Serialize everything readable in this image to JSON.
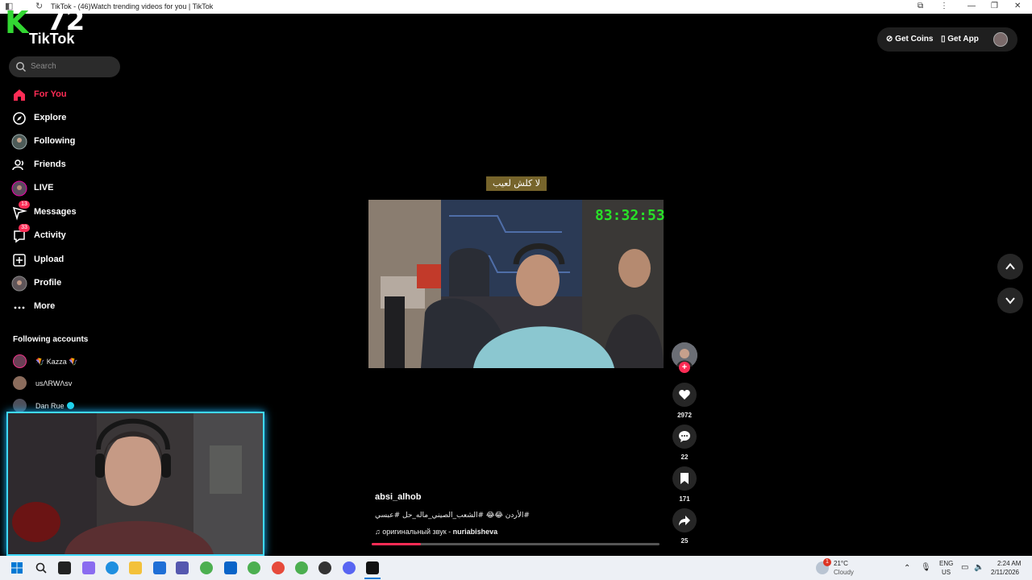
{
  "browser": {
    "title": "TikTok - (46)Watch trending videos for you | TikTok"
  },
  "overlay_logo": {
    "k": "K",
    "number": "72"
  },
  "app": {
    "logo_text": "TikTok"
  },
  "search": {
    "placeholder": "Search"
  },
  "sidebar": {
    "items": [
      {
        "label": "For You",
        "icon": "home-icon",
        "active": true
      },
      {
        "label": "Explore",
        "icon": "compass-icon"
      },
      {
        "label": "Following",
        "icon": "following-avatar-icon"
      },
      {
        "label": "Friends",
        "icon": "friends-icon"
      },
      {
        "label": "LIVE",
        "icon": "live-avatar-icon"
      },
      {
        "label": "Messages",
        "icon": "messages-icon",
        "badge": "13"
      },
      {
        "label": "Activity",
        "icon": "activity-icon",
        "badge": "33"
      },
      {
        "label": "Upload",
        "icon": "upload-icon"
      },
      {
        "label": "Profile",
        "icon": "profile-avatar-icon"
      },
      {
        "label": "More",
        "icon": "more-icon"
      }
    ],
    "following_title": "Following accounts",
    "accounts": [
      {
        "name": "🪁 Kazza 🪁"
      },
      {
        "name": "usɅRWɅsv"
      },
      {
        "name": "Dan Rue"
      }
    ]
  },
  "header": {
    "get_coins": "Get Coins",
    "get_app": "Get App"
  },
  "video": {
    "caption_overlay": "لا كلش لعيب",
    "timer": "83:32:53",
    "author": "absi_alhob",
    "description": "#الأردن 😂😂 #الشعب_الصيني_ماله_حل #عبسي",
    "music_prefix": "оригинальный звук - ",
    "music_artist": "nuriabisheva",
    "progress": 0.17
  },
  "actions": {
    "likes": "2972",
    "comments": "22",
    "saves": "171",
    "shares": "25"
  },
  "taskbar": {
    "weather_temp": "21°C",
    "weather_desc": "Cloudy",
    "weather_badge": "1",
    "lang_top": "ENG",
    "lang_bottom": "US",
    "time": "2:24 AM",
    "date": "2/11/2026"
  },
  "colors": {
    "accent": "#fe2c55",
    "webcam_border": "#3fd9ff",
    "timer": "#28e028"
  }
}
